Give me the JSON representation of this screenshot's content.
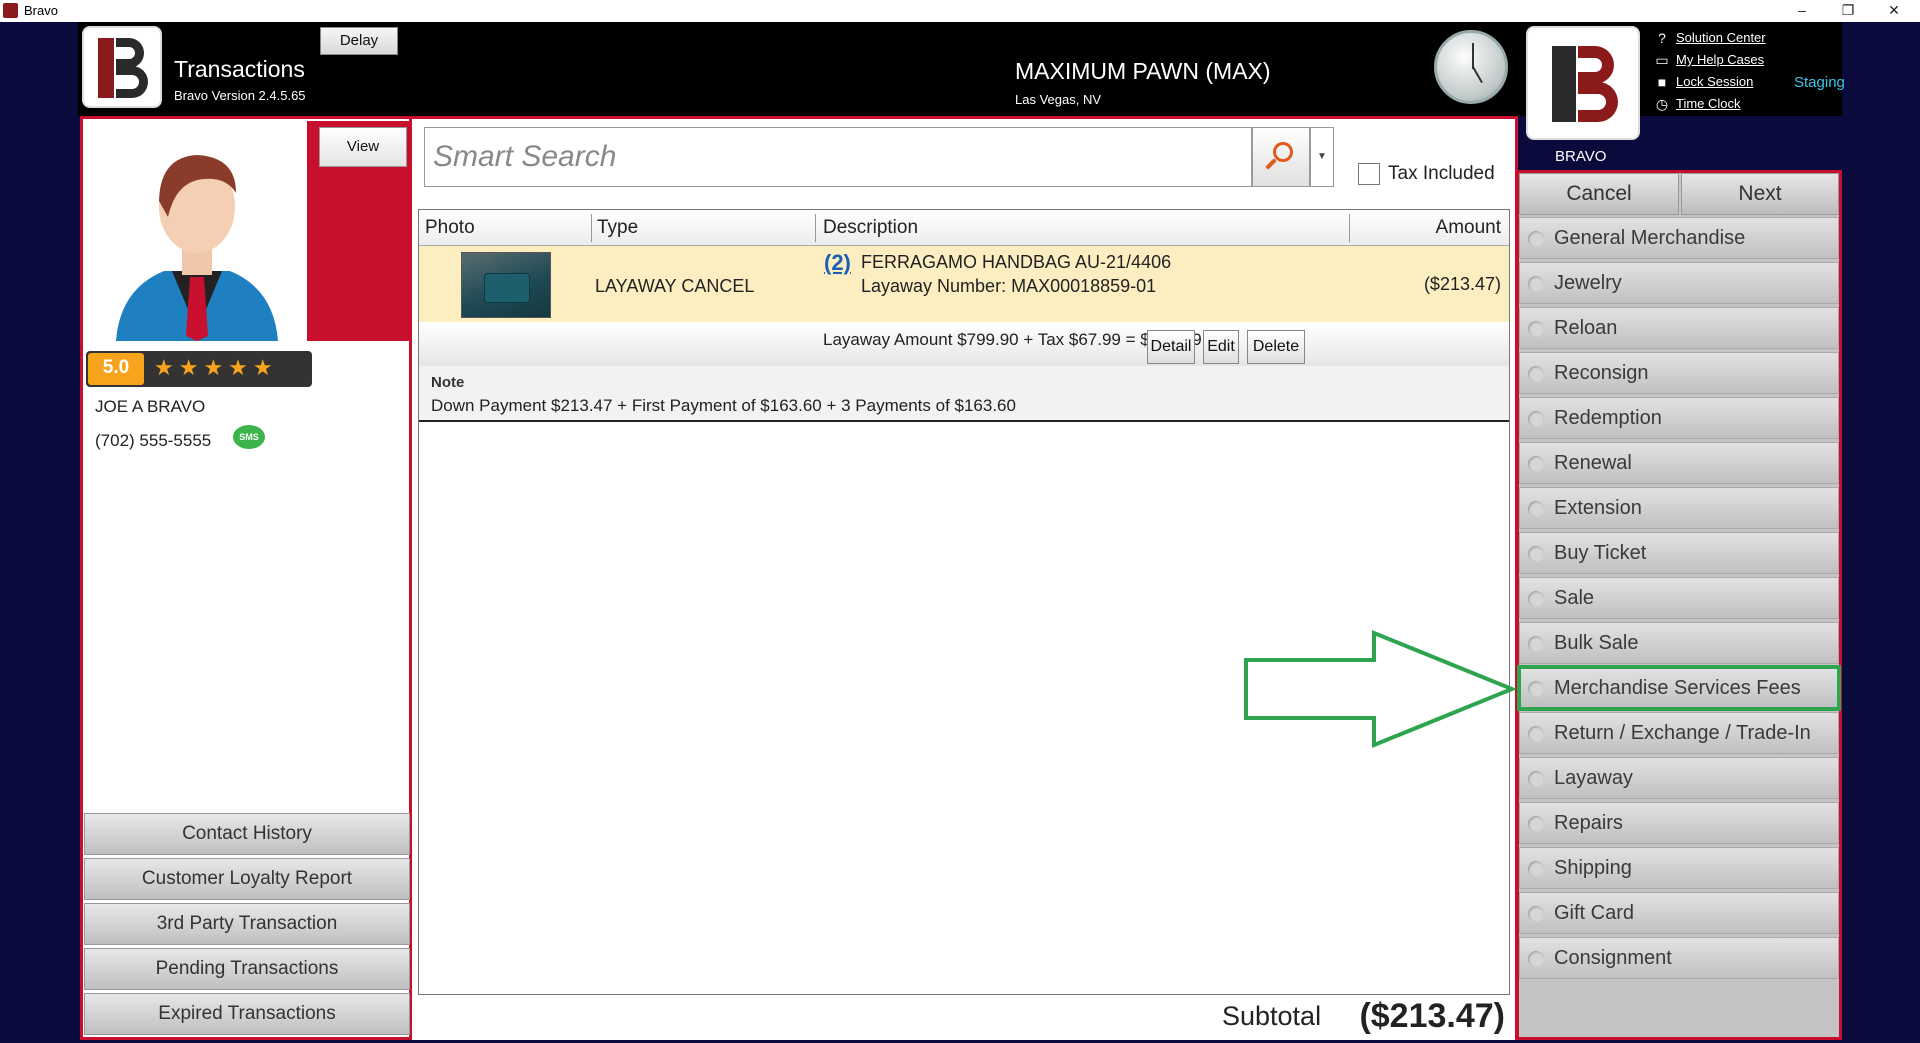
{
  "window": {
    "title": "Bravo",
    "minimize": "–",
    "restore": "❐",
    "close": "✕"
  },
  "header": {
    "app_title": "Transactions",
    "version": "Bravo Version 2.4.5.65",
    "delay_label": "Delay",
    "store_name": "MAXIMUM PAWN (MAX)",
    "store_location": "Las Vegas, NV",
    "help_links": [
      {
        "label": "Solution Center",
        "icon": "question-icon"
      },
      {
        "label": "My Help Cases",
        "icon": "folder-icon"
      },
      {
        "label": "Lock Session",
        "icon": "lock-icon"
      },
      {
        "label": "Time Clock",
        "icon": "clock-icon"
      }
    ],
    "environment": "Staging",
    "user": "BRAVO"
  },
  "customer": {
    "view_label": "View",
    "rating": "5.0",
    "stars": "★★★★★",
    "name": "JOE A BRAVO",
    "phone": "(702) 555-5555",
    "sms_label": "SMS"
  },
  "left_menu": [
    "Contact History",
    "Customer Loyalty Report",
    "3rd Party Transaction",
    "Pending Transactions",
    "Expired Transactions"
  ],
  "search": {
    "placeholder": "Smart Search",
    "tax_included_label": "Tax Included"
  },
  "table": {
    "columns": [
      "Photo",
      "Type",
      "Description",
      "Amount"
    ],
    "rows": [
      {
        "type": "LAYAWAY CANCEL",
        "qty_link": "(2)",
        "description": "FERRAGAMO HANDBAG AU-21/4406",
        "layaway_number": "Layaway Number: MAX00018859-01",
        "amount": "($213.47)",
        "layaway_amount": "Layaway Amount $799.90 + Tax $67.99 = $867.89",
        "actions": [
          "Detail",
          "Edit",
          "Delete"
        ],
        "note_label": "Note",
        "note": "Down Payment $213.47 + First Payment of $163.60 + 3 Payments of $163.60"
      }
    ]
  },
  "subtotal": {
    "label": "Subtotal",
    "value": "($213.47)"
  },
  "nav": {
    "cancel": "Cancel",
    "next": "Next"
  },
  "transaction_types": [
    "General Merchandise",
    "Jewelry",
    "Reloan",
    "Reconsign",
    "Redemption",
    "Renewal",
    "Extension",
    "Buy Ticket",
    "Sale",
    "Bulk Sale",
    "Merchandise Services Fees",
    "Return / Exchange / Trade-In",
    "Layaway",
    "Repairs",
    "Shipping",
    "Gift Card",
    "Consignment"
  ],
  "highlighted_type": "Merchandise Services Fees",
  "colors": {
    "accent_red": "#c8102e",
    "highlight_green": "#2ea44f",
    "staging_blue": "#3ec3e8",
    "rating_orange": "#f7a31c"
  }
}
